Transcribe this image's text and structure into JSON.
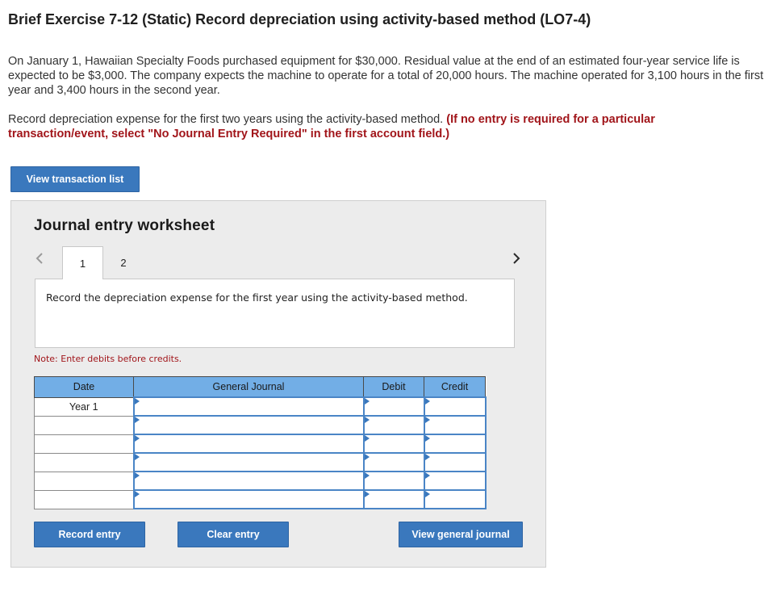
{
  "header": {
    "title": "Brief Exercise 7-12 (Static) Record depreciation using activity-based method (LO7-4)"
  },
  "problem": {
    "text": "On January 1, Hawaiian Specialty Foods purchased equipment for $30,000. Residual value at the end of an estimated four-year service life is expected to be $3,000. The company expects the machine to operate for a total of 20,000 hours. The machine operated for 3,100 hours in the first year and 3,400 hours in the second year."
  },
  "instruction": {
    "text": "Record depreciation expense for the first two years using the activity-based method.",
    "emphasis": "(If no entry is required for a particular transaction/event, select \"No Journal Entry Required\" in the first account field.)"
  },
  "buttons": {
    "view_transaction_list": "View transaction list",
    "record_entry": "Record entry",
    "clear_entry": "Clear entry",
    "view_general_journal": "View general journal"
  },
  "worksheet": {
    "title": "Journal entry worksheet",
    "tabs": [
      "1",
      "2"
    ],
    "active_tab": "1",
    "task_text": "Record the depreciation expense for the first year using the activity-based method.",
    "note": "Note: Enter debits before credits."
  },
  "journal": {
    "headers": {
      "date": "Date",
      "general_journal": "General Journal",
      "debit": "Debit",
      "credit": "Credit"
    },
    "rows": [
      {
        "date": "Year 1",
        "account": "",
        "debit": "",
        "credit": ""
      },
      {
        "date": "",
        "account": "",
        "debit": "",
        "credit": ""
      },
      {
        "date": "",
        "account": "",
        "debit": "",
        "credit": ""
      },
      {
        "date": "",
        "account": "",
        "debit": "",
        "credit": ""
      },
      {
        "date": "",
        "account": "",
        "debit": "",
        "credit": ""
      },
      {
        "date": "",
        "account": "",
        "debit": "",
        "credit": ""
      }
    ]
  },
  "icons": {
    "prev": "chevron-left-icon",
    "next": "chevron-right-icon"
  },
  "colors": {
    "accent": "#3a78bd",
    "table_header": "#72aee6",
    "emphasis": "#a1151a",
    "worksheet_bg": "#ececec"
  }
}
